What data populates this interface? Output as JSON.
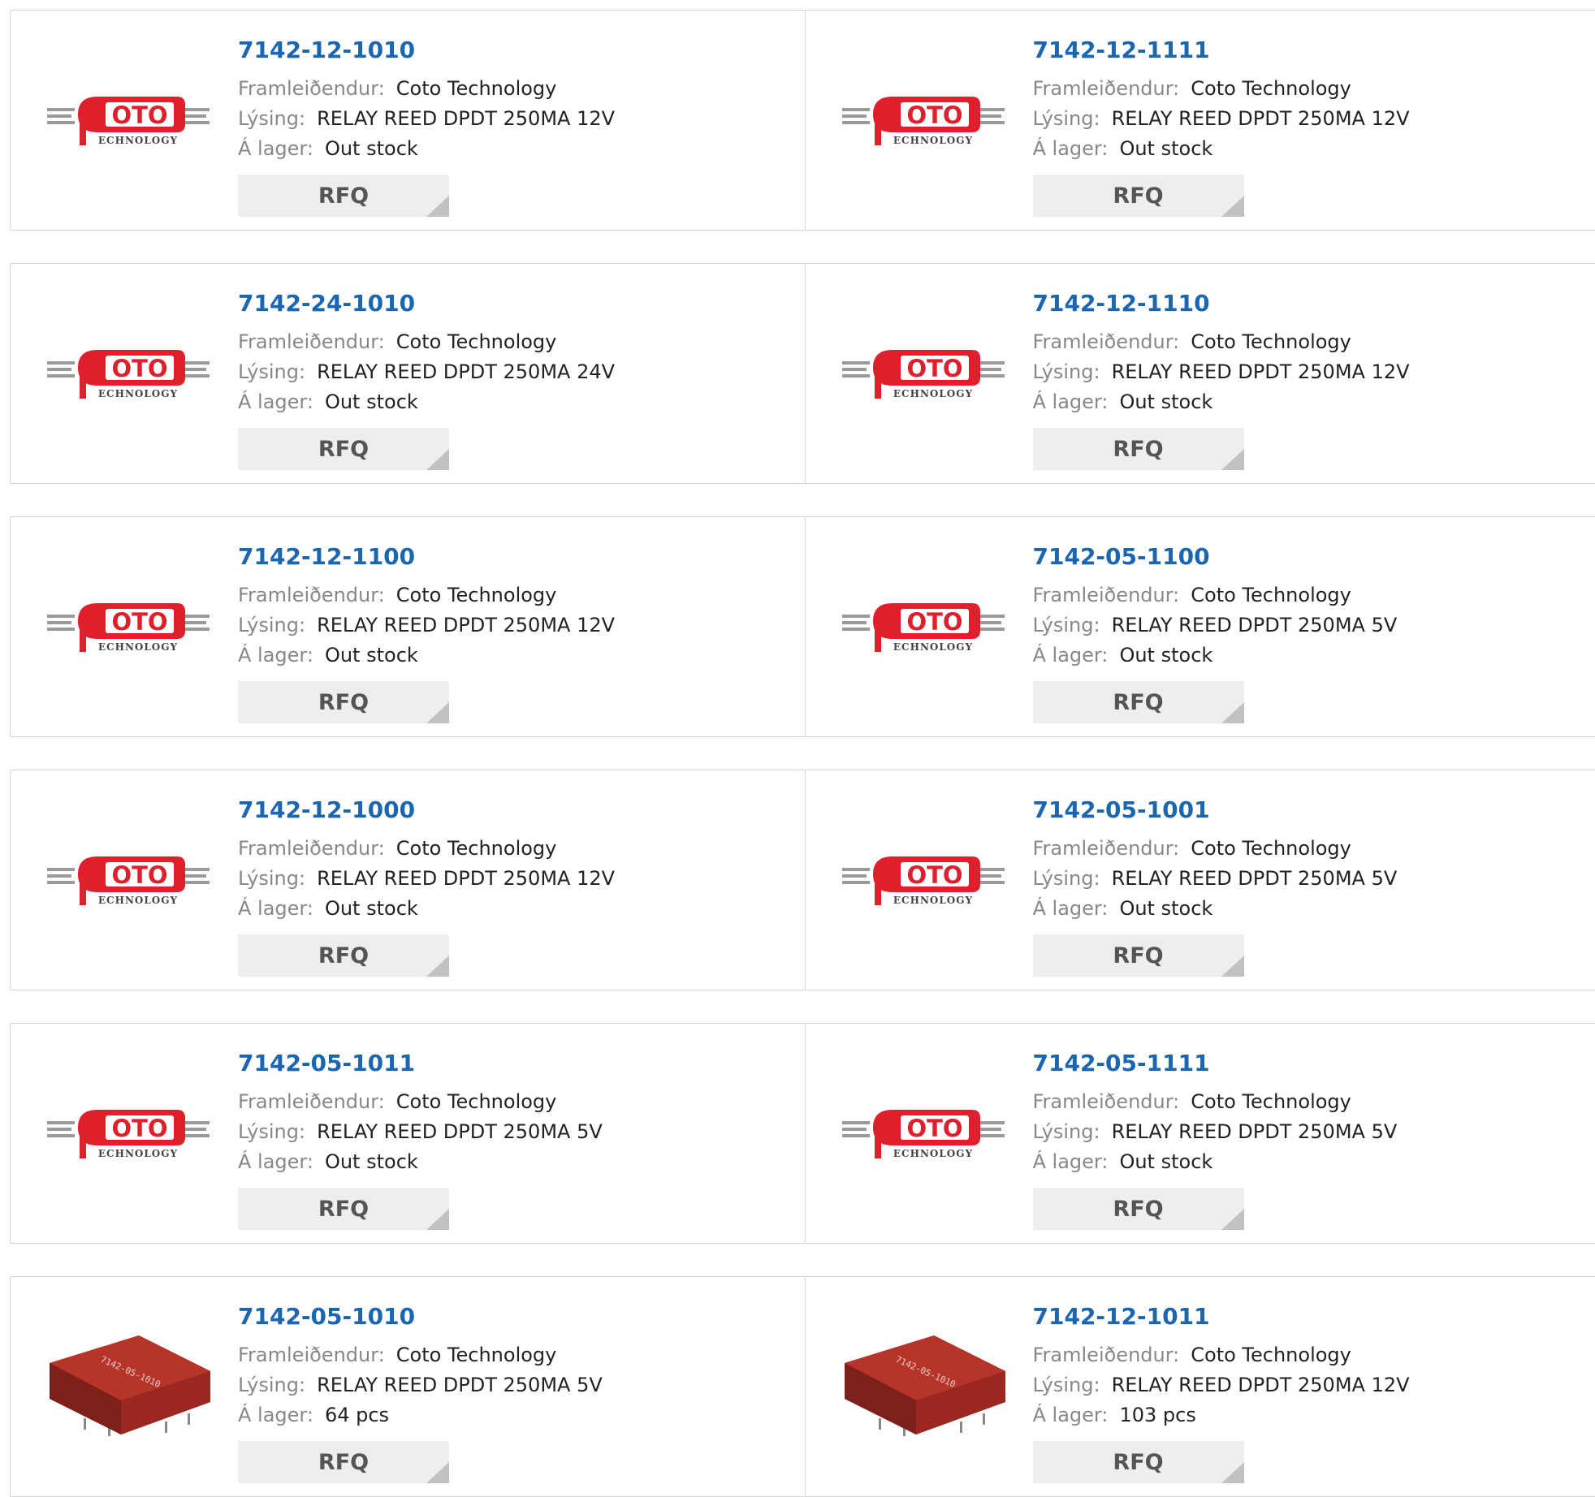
{
  "labels": {
    "manufacturer": "Framleiðendur:",
    "description": "Lýsing:",
    "stock": "Á lager:",
    "rfq": "RFQ"
  },
  "colors": {
    "part_link": "#1b66b1",
    "logo_red": "#e01f2c",
    "relay_red": "#a52a23",
    "border": "#d6d6d6"
  },
  "logo": {
    "main": "OTO",
    "sub": "ECHNOLOGY"
  },
  "relay_marking": "7142-05-1010",
  "products": [
    {
      "part": "7142-12-1010",
      "manufacturer": "Coto Technology",
      "description": "RELAY REED DPDT 250MA 12V",
      "stock": "Out stock",
      "image": "coto-logo"
    },
    {
      "part": "7142-12-1111",
      "manufacturer": "Coto Technology",
      "description": "RELAY REED DPDT 250MA 12V",
      "stock": "Out stock",
      "image": "coto-logo"
    },
    {
      "part": "7142-24-1010",
      "manufacturer": "Coto Technology",
      "description": "RELAY REED DPDT 250MA 24V",
      "stock": "Out stock",
      "image": "coto-logo"
    },
    {
      "part": "7142-12-1110",
      "manufacturer": "Coto Technology",
      "description": "RELAY REED DPDT 250MA 12V",
      "stock": "Out stock",
      "image": "coto-logo"
    },
    {
      "part": "7142-12-1100",
      "manufacturer": "Coto Technology",
      "description": "RELAY REED DPDT 250MA 12V",
      "stock": "Out stock",
      "image": "coto-logo"
    },
    {
      "part": "7142-05-1100",
      "manufacturer": "Coto Technology",
      "description": "RELAY REED DPDT 250MA 5V",
      "stock": "Out stock",
      "image": "coto-logo"
    },
    {
      "part": "7142-12-1000",
      "manufacturer": "Coto Technology",
      "description": "RELAY REED DPDT 250MA 12V",
      "stock": "Out stock",
      "image": "coto-logo"
    },
    {
      "part": "7142-05-1001",
      "manufacturer": "Coto Technology",
      "description": "RELAY REED DPDT 250MA 5V",
      "stock": "Out stock",
      "image": "coto-logo"
    },
    {
      "part": "7142-05-1011",
      "manufacturer": "Coto Technology",
      "description": "RELAY REED DPDT 250MA 5V",
      "stock": "Out stock",
      "image": "coto-logo"
    },
    {
      "part": "7142-05-1111",
      "manufacturer": "Coto Technology",
      "description": "RELAY REED DPDT 250MA 5V",
      "stock": "Out stock",
      "image": "coto-logo"
    },
    {
      "part": "7142-05-1010",
      "manufacturer": "Coto Technology",
      "description": "RELAY REED DPDT 250MA 5V",
      "stock": "64 pcs",
      "image": "relay-photo"
    },
    {
      "part": "7142-12-1011",
      "manufacturer": "Coto Technology",
      "description": "RELAY REED DPDT 250MA 12V",
      "stock": "103 pcs",
      "image": "relay-photo"
    }
  ]
}
